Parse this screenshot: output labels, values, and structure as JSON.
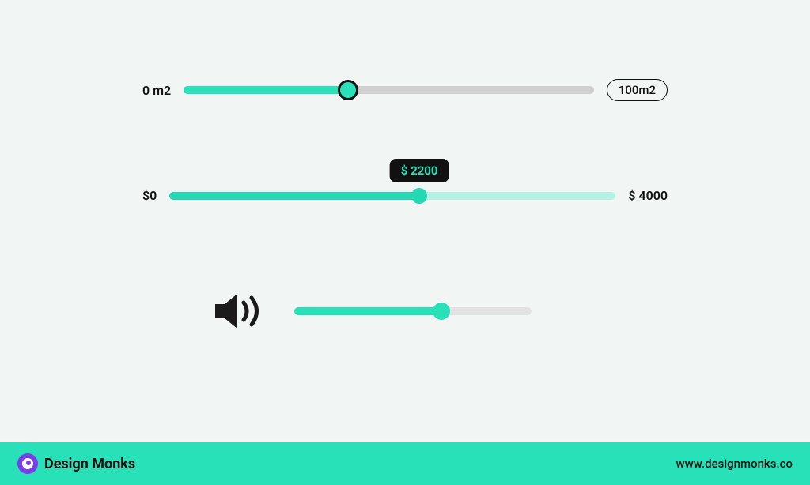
{
  "sliders": {
    "area": {
      "min_label": "0 m2",
      "max_label": "100m2",
      "percent": 40
    },
    "price": {
      "min_label": "$0",
      "max_label": "$ 4000",
      "tooltip": "$ 2200",
      "percent": 56
    },
    "volume": {
      "percent": 62
    }
  },
  "footer": {
    "brand": "Design Monks",
    "url": "www.designmonks.co"
  },
  "colors": {
    "accent": "#28e1b9",
    "dark": "#111111",
    "track_inactive_1": "#cfcfcf",
    "track_inactive_2": "#b6f2e3",
    "track_inactive_3": "#e2e2e2"
  }
}
